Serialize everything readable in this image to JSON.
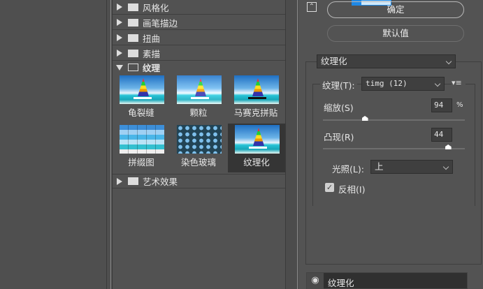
{
  "categories": [
    {
      "label": "风格化",
      "expanded": false
    },
    {
      "label": "画笔描边",
      "expanded": false
    },
    {
      "label": "扭曲",
      "expanded": false
    },
    {
      "label": "素描",
      "expanded": false
    },
    {
      "label": "纹理",
      "expanded": true
    },
    {
      "label": "艺术效果",
      "expanded": false
    }
  ],
  "filters": [
    {
      "label": "龟裂缝"
    },
    {
      "label": "颗粒"
    },
    {
      "label": "马赛克拼贴"
    },
    {
      "label": "拼缀图"
    },
    {
      "label": "染色玻璃"
    },
    {
      "label": "纹理化",
      "selected": true
    }
  ],
  "buttons": {
    "ok": "确定",
    "default": "默认值"
  },
  "filter_select": "纹理化",
  "settings": {
    "texture_label": "纹理(T):",
    "texture_value": "timg (12)",
    "scale_label": "缩放(S)",
    "scale_value": "94",
    "scale_unit": "%",
    "scale_percent": 94,
    "relief_label": "凸现(R)",
    "relief_value": "44",
    "relief_max": 50,
    "light_label": "光照(L):",
    "light_value": "上",
    "invert_label": "反相(I)",
    "invert_checked": true
  },
  "layer": {
    "label": "纹理化",
    "visible": true
  },
  "colors": {
    "accent": "#1e88e5",
    "panel": "#535353"
  }
}
